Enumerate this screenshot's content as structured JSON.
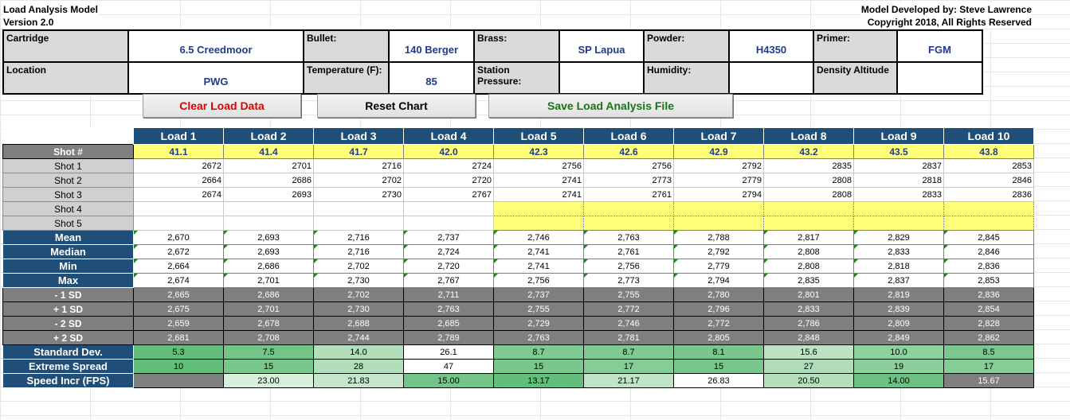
{
  "header": {
    "title": "Load Analysis Model",
    "version": "Version 2.0",
    "credit": "Model Developed by: Steve Lawrence",
    "copyright": "Copyright 2018, All Rights Reserved"
  },
  "info": {
    "cartridge_label": "Cartridge",
    "cartridge": "6.5 Creedmoor",
    "bullet_label": "Bullet:",
    "bullet": "140 Berger",
    "brass_label": "Brass:",
    "brass": "SP Lapua",
    "powder_label": "Powder:",
    "powder": "H4350",
    "primer_label": "Primer:",
    "primer": "FGM",
    "location_label": "Location",
    "location": "PWG",
    "temperature_label": "Temperature (F):",
    "temperature": "85",
    "pressure_label": "Station Pressure:",
    "pressure": "",
    "humidity_label": "Humidity:",
    "humidity": "",
    "density_label": "Density Altitude",
    "density": ""
  },
  "buttons": {
    "clear": "Clear Load Data",
    "reset": "Reset Chart",
    "save": "Save Load Analysis File"
  },
  "colors": {
    "clear": "#e00000",
    "reset": "#000000",
    "save": "#157515"
  },
  "table": {
    "loads": [
      "Load 1",
      "Load 2",
      "Load 3",
      "Load 4",
      "Load 5",
      "Load 6",
      "Load 7",
      "Load 8",
      "Load 9",
      "Load 10"
    ],
    "shot_label": "Shot #",
    "charges": [
      "41.1",
      "41.4",
      "41.7",
      "42.0",
      "42.3",
      "42.6",
      "42.9",
      "43.2",
      "43.5",
      "43.8"
    ],
    "shots": [
      {
        "label": "Shot 1",
        "values": [
          "2672",
          "2701",
          "2716",
          "2724",
          "2756",
          "2756",
          "2792",
          "2835",
          "2837",
          "2853"
        ]
      },
      {
        "label": "Shot 2",
        "values": [
          "2664",
          "2686",
          "2702",
          "2720",
          "2741",
          "2773",
          "2779",
          "2808",
          "2818",
          "2846"
        ]
      },
      {
        "label": "Shot 3",
        "values": [
          "2674",
          "2693",
          "2730",
          "2767",
          "2741",
          "2761",
          "2794",
          "2808",
          "2833",
          "2836"
        ]
      },
      {
        "label": "Shot 4",
        "values": [
          "",
          "",
          "",
          "",
          "",
          "",
          "",
          "",
          "",
          ""
        ]
      },
      {
        "label": "Shot 5",
        "values": [
          "",
          "",
          "",
          "",
          "",
          "",
          "",
          "",
          "",
          ""
        ]
      }
    ],
    "stats": [
      {
        "label": "Mean",
        "values": [
          "2,670",
          "2,693",
          "2,716",
          "2,737",
          "2,746",
          "2,763",
          "2,788",
          "2,817",
          "2,829",
          "2,845"
        ]
      },
      {
        "label": "Median",
        "values": [
          "2,672",
          "2,693",
          "2,716",
          "2,724",
          "2,741",
          "2,761",
          "2,792",
          "2,808",
          "2,833",
          "2,846"
        ]
      },
      {
        "label": "Min",
        "values": [
          "2,664",
          "2,686",
          "2,702",
          "2,720",
          "2,741",
          "2,756",
          "2,779",
          "2,808",
          "2,818",
          "2,836"
        ]
      },
      {
        "label": "Max",
        "values": [
          "2,674",
          "2,701",
          "2,730",
          "2,767",
          "2,756",
          "2,773",
          "2,794",
          "2,835",
          "2,837",
          "2,853"
        ]
      }
    ],
    "sd_rows": [
      {
        "label": "- 1 SD",
        "values": [
          "2,665",
          "2,686",
          "2,702",
          "2,711",
          "2,737",
          "2,755",
          "2,780",
          "2,801",
          "2,819",
          "2,836"
        ]
      },
      {
        "label": "+ 1 SD",
        "values": [
          "2,675",
          "2,701",
          "2,730",
          "2,763",
          "2,755",
          "2,772",
          "2,796",
          "2,833",
          "2,839",
          "2,854"
        ]
      },
      {
        "label": "- 2 SD",
        "values": [
          "2,659",
          "2,678",
          "2,688",
          "2,685",
          "2,729",
          "2,746",
          "2,772",
          "2,786",
          "2,809",
          "2,828"
        ]
      },
      {
        "label": "+ 2 SD",
        "values": [
          "2,681",
          "2,708",
          "2,744",
          "2,789",
          "2,763",
          "2,781",
          "2,805",
          "2,848",
          "2,849",
          "2,862"
        ]
      }
    ],
    "metrics": [
      {
        "label": "Standard Dev.",
        "values": [
          "5.3",
          "7.5",
          "14.0",
          "26.1",
          "8.7",
          "8.7",
          "8.1",
          "15.6",
          "10.0",
          "8.5"
        ],
        "colors": [
          "#63be7b",
          "#72c487",
          "#b2deba",
          "#ffffff",
          "#7fc992",
          "#7fc992",
          "#7ac78e",
          "#bde3c4",
          "#8fd09f",
          "#7bc78f"
        ]
      },
      {
        "label": "Extreme Spread",
        "values": [
          "10",
          "15",
          "28",
          "47",
          "15",
          "17",
          "15",
          "27",
          "19",
          "17"
        ],
        "colors": [
          "#63be7b",
          "#7ac78e",
          "#b2deba",
          "#ffffff",
          "#7ac78e",
          "#86cc97",
          "#7ac78e",
          "#b0ddb9",
          "#8ccf9c",
          "#86cc97"
        ]
      },
      {
        "label": "Speed Incr (FPS)",
        "values": [
          "",
          "23.00",
          "21.83",
          "15.00",
          "13.17",
          "21.17",
          "26.83",
          "20.50",
          "14.00",
          "15.67"
        ],
        "colors": [
          "#7f7f7f",
          "#d7efdb",
          "#c6e7cc",
          "#73c488",
          "#63be7b",
          "#bfe4c6",
          "#ffffff",
          "#b5dfbd",
          "#6ac181",
          "#7f7f7f"
        ]
      }
    ]
  }
}
